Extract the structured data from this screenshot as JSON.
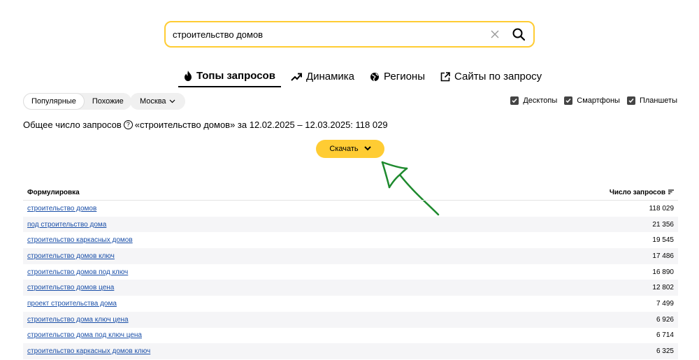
{
  "search": {
    "value": "строительство домов"
  },
  "tabs": [
    {
      "label": "Топы запросов",
      "icon": "fire-icon"
    },
    {
      "label": "Динамика",
      "icon": "trend-icon"
    },
    {
      "label": "Регионы",
      "icon": "globe-icon"
    },
    {
      "label": "Сайты по запросу",
      "icon": "external-link-icon"
    }
  ],
  "filters": {
    "segments": [
      "Популярные",
      "Похожие"
    ],
    "region": "Москва",
    "devices": [
      "Десктопы",
      "Смартфоны",
      "Планшеты"
    ]
  },
  "total": {
    "prefix": "Общее число запросов",
    "rest": "«строительство домов» за 12.02.2025 – 12.03.2025: 118 029"
  },
  "download": {
    "label": "Скачать"
  },
  "table": {
    "col_query": "Формулировка",
    "col_count": "Число запросов",
    "rows": [
      {
        "query": "строительство домов",
        "count": "118 029"
      },
      {
        "query": "под строительство дома",
        "count": "21 356"
      },
      {
        "query": "строительство каркасных домов",
        "count": "19 545"
      },
      {
        "query": "строительство домов ключ",
        "count": "17 486"
      },
      {
        "query": "строительство домов под ключ",
        "count": "16 890"
      },
      {
        "query": "строительство домов цена",
        "count": "12 802"
      },
      {
        "query": "проект строительства дома",
        "count": "7 499"
      },
      {
        "query": "строительство дома ключ цена",
        "count": "6 926"
      },
      {
        "query": "строительство дома под ключ цена",
        "count": "6 714"
      },
      {
        "query": "строительство каркасных домов ключ",
        "count": "6 325"
      }
    ]
  },
  "colors": {
    "accent": "#ffcc33",
    "link": "#1a4fa8",
    "arrow": "#1e8a2e"
  }
}
